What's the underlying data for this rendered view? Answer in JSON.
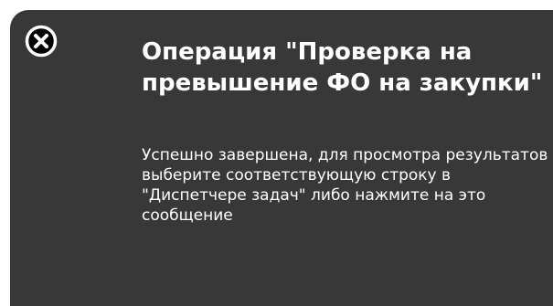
{
  "notification": {
    "title": "Операция \"Проверка на превышение ФО на закупки\"",
    "message": "Успешно завершена, для просмотра результатов выберите соответствующую строку в \"Диспетчере задач\" либо нажмите на это сообщение",
    "close_icon": "close-circle-icon",
    "colors": {
      "background": "#383838",
      "text": "#ffffff"
    }
  }
}
